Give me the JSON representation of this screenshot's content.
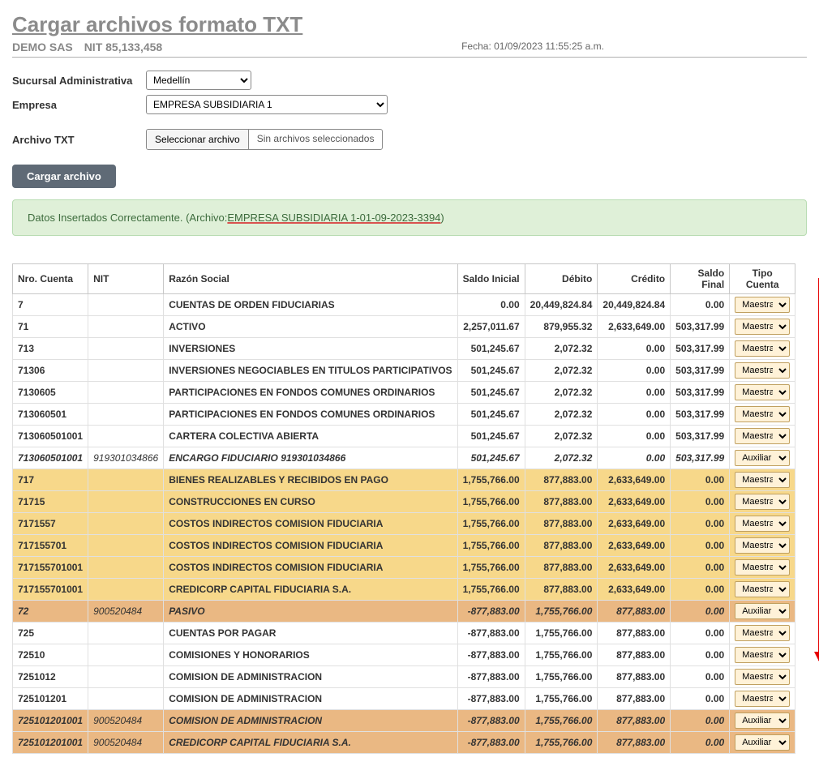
{
  "title": "Cargar archivos formato TXT",
  "company": "DEMO SAS",
  "nit_label": "NIT 85,133,458",
  "fecha": "Fecha: 01/09/2023 11:55:25 a.m.",
  "fields": {
    "sucursal_label": "Sucursal Administrativa",
    "sucursal_value": "Medellín",
    "empresa_label": "Empresa",
    "empresa_value": "EMPRESA SUBSIDIARIA 1",
    "archivo_label": "Archivo TXT",
    "file_button": "Seleccionar archivo",
    "file_status": "Sin archivos seleccionados",
    "load_button": "Cargar archivo"
  },
  "alert": {
    "prefix": "Datos Insertados Correctamente. (Archivo: ",
    "link": "EMPRESA SUBSIDIARIA 1-01-09-2023-3394",
    "suffix": ")"
  },
  "table": {
    "headers": [
      "Nro. Cuenta",
      "NIT",
      "Razón Social",
      "Saldo Inicial",
      "Débito",
      "Crédito",
      "Saldo Final",
      "Tipo Cuenta"
    ],
    "tipo_options": [
      "Maestra",
      "Auxiliar"
    ],
    "rows": [
      {
        "num": "7",
        "nit": "",
        "razon": "CUENTAS DE ORDEN FIDUCIARIAS",
        "si": "0.00",
        "de": "20,449,824.84",
        "cr": "20,449,824.84",
        "sf": "0.00",
        "tipo": "Maestra",
        "cls": ""
      },
      {
        "num": "71",
        "nit": "",
        "razon": "ACTIVO",
        "si": "2,257,011.67",
        "de": "879,955.32",
        "cr": "2,633,649.00",
        "sf": "503,317.99",
        "tipo": "Maestra",
        "cls": ""
      },
      {
        "num": "713",
        "nit": "",
        "razon": "INVERSIONES",
        "si": "501,245.67",
        "de": "2,072.32",
        "cr": "0.00",
        "sf": "503,317.99",
        "tipo": "Maestra",
        "cls": ""
      },
      {
        "num": "71306",
        "nit": "",
        "razon": "INVERSIONES NEGOCIABLES EN TITULOS PARTICIPATIVOS",
        "si": "501,245.67",
        "de": "2,072.32",
        "cr": "0.00",
        "sf": "503,317.99",
        "tipo": "Maestra",
        "cls": ""
      },
      {
        "num": "7130605",
        "nit": "",
        "razon": "PARTICIPACIONES EN FONDOS COMUNES ORDINARIOS",
        "si": "501,245.67",
        "de": "2,072.32",
        "cr": "0.00",
        "sf": "503,317.99",
        "tipo": "Maestra",
        "cls": ""
      },
      {
        "num": "713060501",
        "nit": "",
        "razon": "PARTICIPACIONES EN FONDOS COMUNES ORDINARIOS",
        "si": "501,245.67",
        "de": "2,072.32",
        "cr": "0.00",
        "sf": "503,317.99",
        "tipo": "Maestra",
        "cls": ""
      },
      {
        "num": "713060501001",
        "nit": "",
        "razon": "CARTERA COLECTIVA ABIERTA",
        "si": "501,245.67",
        "de": "2,072.32",
        "cr": "0.00",
        "sf": "503,317.99",
        "tipo": "Maestra",
        "cls": ""
      },
      {
        "num": "713060501001",
        "nit": "919301034866",
        "razon": "ENCARGO FIDUCIARIO 919301034866",
        "si": "501,245.67",
        "de": "2,072.32",
        "cr": "0.00",
        "sf": "503,317.99",
        "tipo": "Auxiliar",
        "cls": "italic"
      },
      {
        "num": "717",
        "nit": "",
        "razon": "BIENES REALIZABLES Y RECIBIDOS EN PAGO",
        "si": "1,755,766.00",
        "de": "877,883.00",
        "cr": "2,633,649.00",
        "sf": "0.00",
        "tipo": "Maestra",
        "cls": "yellow"
      },
      {
        "num": "71715",
        "nit": "",
        "razon": "CONSTRUCCIONES EN CURSO",
        "si": "1,755,766.00",
        "de": "877,883.00",
        "cr": "2,633,649.00",
        "sf": "0.00",
        "tipo": "Maestra",
        "cls": "yellow"
      },
      {
        "num": "7171557",
        "nit": "",
        "razon": "COSTOS INDIRECTOS COMISION FIDUCIARIA",
        "si": "1,755,766.00",
        "de": "877,883.00",
        "cr": "2,633,649.00",
        "sf": "0.00",
        "tipo": "Maestra",
        "cls": "yellow"
      },
      {
        "num": "717155701",
        "nit": "",
        "razon": "COSTOS INDIRECTOS COMISION FIDUCIARIA",
        "si": "1,755,766.00",
        "de": "877,883.00",
        "cr": "2,633,649.00",
        "sf": "0.00",
        "tipo": "Maestra",
        "cls": "yellow"
      },
      {
        "num": "717155701001",
        "nit": "",
        "razon": "COSTOS INDIRECTOS COMISION FIDUCIARIA",
        "si": "1,755,766.00",
        "de": "877,883.00",
        "cr": "2,633,649.00",
        "sf": "0.00",
        "tipo": "Maestra",
        "cls": "yellow"
      },
      {
        "num": "717155701001",
        "nit": "",
        "razon": "CREDICORP CAPITAL FIDUCIARIA S.A.",
        "si": "1,755,766.00",
        "de": "877,883.00",
        "cr": "2,633,649.00",
        "sf": "0.00",
        "tipo": "Maestra",
        "cls": "yellow"
      },
      {
        "num": "72",
        "nit": "900520484",
        "razon": "PASIVO",
        "si": "-877,883.00",
        "de": "1,755,766.00",
        "cr": "877,883.00",
        "sf": "0.00",
        "tipo": "Auxiliar",
        "cls": "orange"
      },
      {
        "num": "725",
        "nit": "",
        "razon": "CUENTAS POR PAGAR",
        "si": "-877,883.00",
        "de": "1,755,766.00",
        "cr": "877,883.00",
        "sf": "0.00",
        "tipo": "Maestra",
        "cls": ""
      },
      {
        "num": "72510",
        "nit": "",
        "razon": "COMISIONES Y HONORARIOS",
        "si": "-877,883.00",
        "de": "1,755,766.00",
        "cr": "877,883.00",
        "sf": "0.00",
        "tipo": "Maestra",
        "cls": ""
      },
      {
        "num": "7251012",
        "nit": "",
        "razon": "COMISION DE ADMINISTRACION",
        "si": "-877,883.00",
        "de": "1,755,766.00",
        "cr": "877,883.00",
        "sf": "0.00",
        "tipo": "Maestra",
        "cls": ""
      },
      {
        "num": "725101201",
        "nit": "",
        "razon": "COMISION DE ADMINISTRACION",
        "si": "-877,883.00",
        "de": "1,755,766.00",
        "cr": "877,883.00",
        "sf": "0.00",
        "tipo": "Maestra",
        "cls": ""
      },
      {
        "num": "725101201001",
        "nit": "900520484",
        "razon": "COMISION DE ADMINISTRACION",
        "si": "-877,883.00",
        "de": "1,755,766.00",
        "cr": "877,883.00",
        "sf": "0.00",
        "tipo": "Auxiliar",
        "cls": "orange"
      },
      {
        "num": "725101201001",
        "nit": "900520484",
        "razon": "CREDICORP CAPITAL FIDUCIARIA S.A.",
        "si": "-877,883.00",
        "de": "1,755,766.00",
        "cr": "877,883.00",
        "sf": "0.00",
        "tipo": "Auxiliar",
        "cls": "orange"
      }
    ]
  }
}
